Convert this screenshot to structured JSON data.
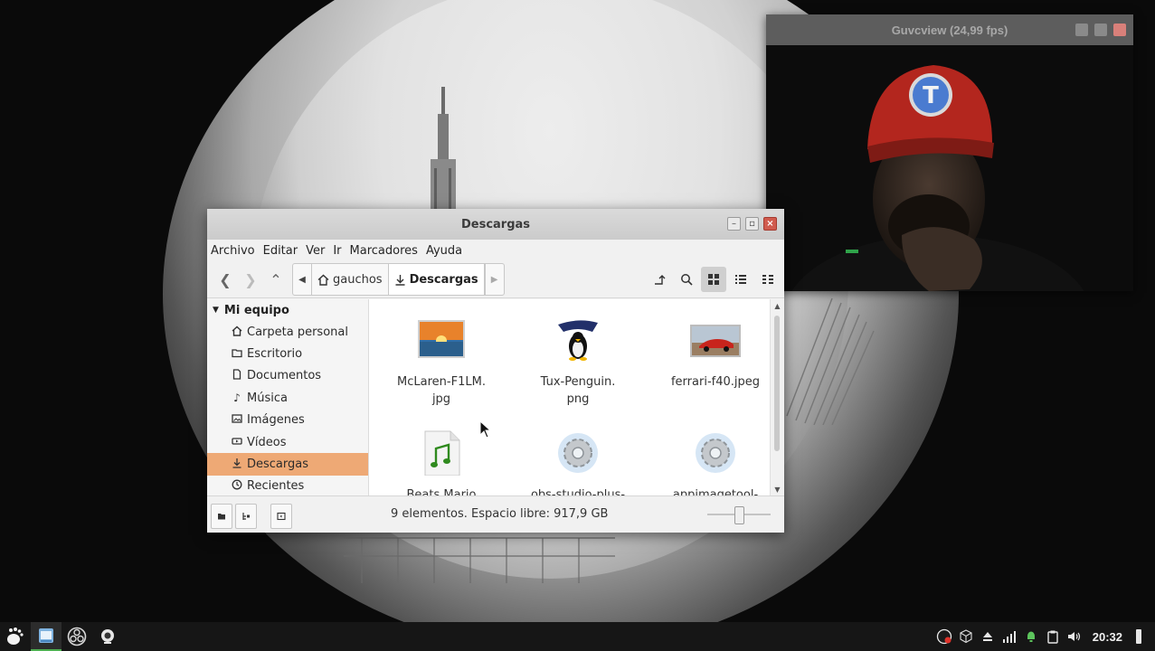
{
  "guvcview": {
    "title": "Guvcview  (24,99 fps)",
    "cap_letter": "T"
  },
  "file_manager": {
    "title": "Descargas",
    "menu": [
      "Archivo",
      "Editar",
      "Ver",
      "Ir",
      "Marcadores",
      "Ayuda"
    ],
    "breadcrumb": {
      "home": "gauchos",
      "current": "Descargas"
    },
    "sidebar": {
      "section": "Mi equipo",
      "items": [
        {
          "label": "Carpeta personal",
          "icon": "home-icon"
        },
        {
          "label": "Escritorio",
          "icon": "folder-icon"
        },
        {
          "label": "Documentos",
          "icon": "document-icon"
        },
        {
          "label": "Música",
          "icon": "music-icon"
        },
        {
          "label": "Imágenes",
          "icon": "image-icon"
        },
        {
          "label": "Vídeos",
          "icon": "video-icon"
        },
        {
          "label": "Descargas",
          "icon": "download-icon",
          "selected": true
        },
        {
          "label": "Recientes",
          "icon": "recent-icon"
        }
      ]
    },
    "files": [
      {
        "line1": "McLaren-F1LM.",
        "line2": "jpg",
        "type": "sunset-image"
      },
      {
        "line1": "Tux-Penguin.",
        "line2": "png",
        "type": "tux-image"
      },
      {
        "line1": "ferrari-f40.jpeg",
        "line2": "",
        "type": "car-image"
      },
      {
        "line1": "Beats Mario",
        "line2": "",
        "type": "audio-file"
      },
      {
        "line1": "obs-studio-plus-",
        "line2": "",
        "type": "gear-file"
      },
      {
        "line1": "appimagetool-",
        "line2": "",
        "type": "gear-file"
      }
    ],
    "status": "9 elementos. Espacio libre: 917,9 GB",
    "zoom_level": 0.5
  },
  "taskbar": {
    "clock": "20:32",
    "accent": "#4caf50"
  }
}
